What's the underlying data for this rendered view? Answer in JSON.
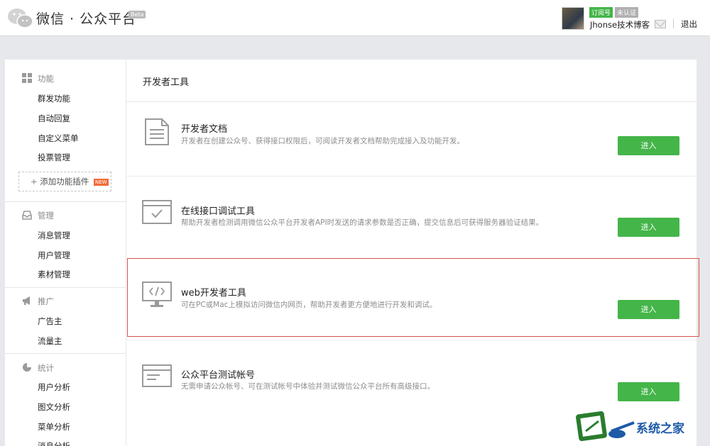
{
  "header": {
    "brand": "微信 · 公众平台",
    "beta": "Beta",
    "tag_subscription": "订阅号",
    "tag_unverified": "未认证",
    "account_name": "Jhonse技术博客",
    "logout": "退出"
  },
  "sidebar": {
    "sections": [
      {
        "title": "功能",
        "icon": "grid-icon",
        "items": [
          "群发功能",
          "自动回复",
          "自定义菜单",
          "投票管理"
        ]
      },
      {
        "title": "管理",
        "icon": "inbox-icon",
        "items": [
          "消息管理",
          "用户管理",
          "素材管理"
        ]
      },
      {
        "title": "推广",
        "icon": "megaphone-icon",
        "items": [
          "广告主",
          "流量主"
        ]
      },
      {
        "title": "统计",
        "icon": "pie-chart-icon",
        "items": [
          "用户分析",
          "图文分析",
          "菜单分析",
          "消息分析"
        ]
      }
    ],
    "add_plugin": "添加功能插件",
    "new_badge": "NEW"
  },
  "main": {
    "title": "开发者工具",
    "tools": [
      {
        "title": "开发者文档",
        "desc": "开发者在创建公众号、获得接口权限后，可阅读开发者文档帮助完成接入及功能开发。",
        "button": "进入",
        "icon": "document-icon"
      },
      {
        "title": "在线接口调试工具",
        "desc": "帮助开发者检测调用微信公众平台开发者API时发送的请求参数是否正确，提交信息后可获得服务器验证结果。",
        "button": "进入",
        "icon": "browser-check-icon"
      },
      {
        "title": "web开发者工具",
        "desc": "可在PC或Mac上模拟访问微信内网页，帮助开发者更方便地进行开发和调试。",
        "button": "进入",
        "icon": "monitor-code-icon"
      },
      {
        "title": "公众平台测试帐号",
        "desc": "无需申请公众帐号、可在测试帐号中体验并测试微信公众平台所有高级接口。",
        "button": "进入",
        "icon": "browser-list-icon"
      }
    ]
  },
  "watermark": {
    "text": "系统之家"
  },
  "colors": {
    "accent_green": "#44b549",
    "highlight_red": "#d9534f"
  }
}
